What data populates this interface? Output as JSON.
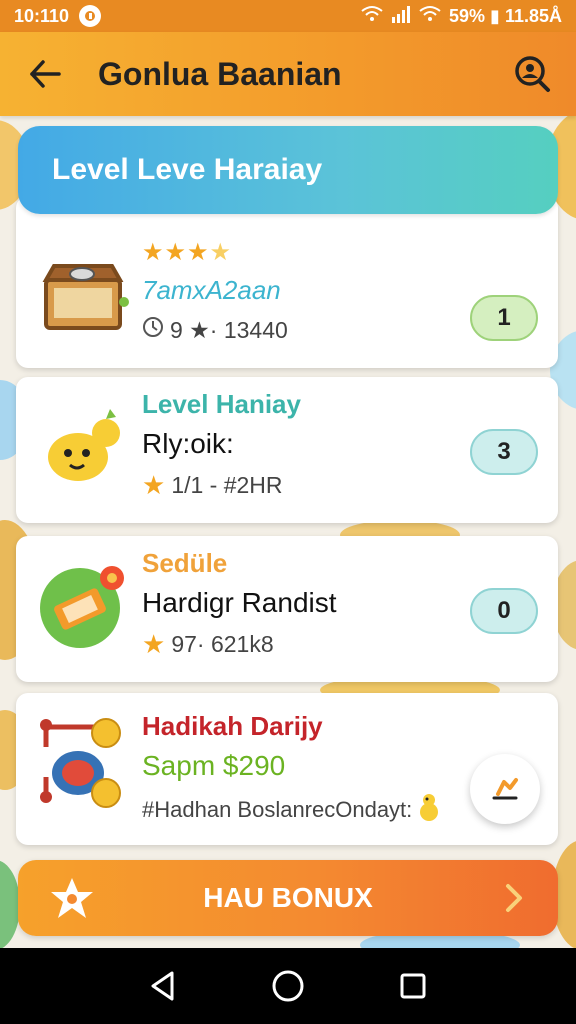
{
  "status_bar": {
    "time": "10:110",
    "right_text": "59% ▮ 11.85Å"
  },
  "app_bar": {
    "title": "Gonlua Baanian"
  },
  "banner": {
    "title": "Level Leve Haraiay"
  },
  "cards": [
    {
      "stars": 4,
      "line1": "7amxA2aan",
      "line2": "",
      "meta": "9 ★· 13440",
      "pill": "1",
      "line1_color": "#3cb4cf",
      "pill_bg": "#d5efc0",
      "pill_border": "#9ed27a"
    },
    {
      "line1": "Level Haniay",
      "line2": "Rly:oik:",
      "meta": "1/1 - #2HR",
      "pill": "3",
      "line1_color": "#3cb4aa",
      "pill_bg": "#cdeeed",
      "pill_border": "#8fd3d3"
    },
    {
      "line1": "Sedüle",
      "line2": "Hardigr Randist",
      "meta": "97· 621k8",
      "pill": "0",
      "line1_color": "#f0a23a",
      "pill_bg": "#cdeeed",
      "pill_border": "#8fd3d3"
    },
    {
      "line1": "Hadikah Darijy",
      "line2": "Sapm $290",
      "meta": "#Hadhan BoslanrecOndayt:",
      "line1_color": "#c4242a",
      "line2_color": "#6bb322"
    }
  ],
  "bonus_button": {
    "label": "HAU BONUX"
  },
  "colors": {
    "accent_orange": "#f39a2b",
    "banner_blue": "#43a9e6",
    "nav_black": "#000000"
  }
}
